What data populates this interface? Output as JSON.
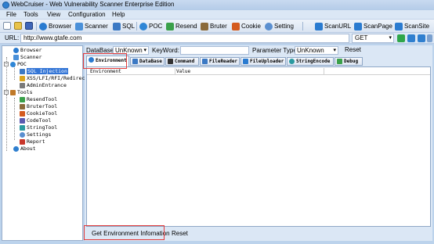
{
  "window": {
    "title": "WebCruiser - Web Vulnerability Scanner Enterprise Edition"
  },
  "menu": {
    "items": [
      "File",
      "Tools",
      "View",
      "Configuration",
      "Help"
    ]
  },
  "toolbar": {
    "browser": "Browser",
    "scanner": "Scanner",
    "sql": "SQL",
    "poc": "POC",
    "resend": "Resend",
    "bruter": "Bruter",
    "cookie": "Cookie",
    "setting": "Setting",
    "scanurl": "ScanURL",
    "scanpage": "ScanPage",
    "scansite": "ScanSite"
  },
  "urlbar": {
    "label": "URL:",
    "value": "http://www.gtafe.com",
    "method": "GET"
  },
  "tree": {
    "browser": "Browser",
    "scanner": "Scanner",
    "poc": "POC",
    "sql_injection": "SQL Injection",
    "xss": "XSS/LFI/RFI/Redirect",
    "admin": "AdminEntrance",
    "tools": "Tools",
    "resend": "ResendTool",
    "bruter": "BruterTool",
    "cookie": "CookieTool",
    "code": "CodeTool",
    "string": "StringTool",
    "settings": "Settings",
    "report": "Report",
    "about": "About"
  },
  "filter": {
    "database_label": "DataBase:",
    "database_value": "UnKnown",
    "keyword_label": "KeyWord:",
    "keyword_value": "",
    "param_label": "Parameter Type:",
    "param_value": "UnKnown",
    "reset": "Reset"
  },
  "tabs": [
    "Environment",
    "DataBase",
    "Command",
    "FileReader",
    "FileUploader",
    "StringEncode",
    "Debug"
  ],
  "grid": {
    "columns": [
      "Environment",
      "Value"
    ]
  },
  "bottom": {
    "get_env": "Get Environment Infomation",
    "reset": "Reset"
  },
  "colors": {
    "selection": "#3375d6",
    "highlight": "#e23a3a",
    "background": "#bcd3ec"
  }
}
